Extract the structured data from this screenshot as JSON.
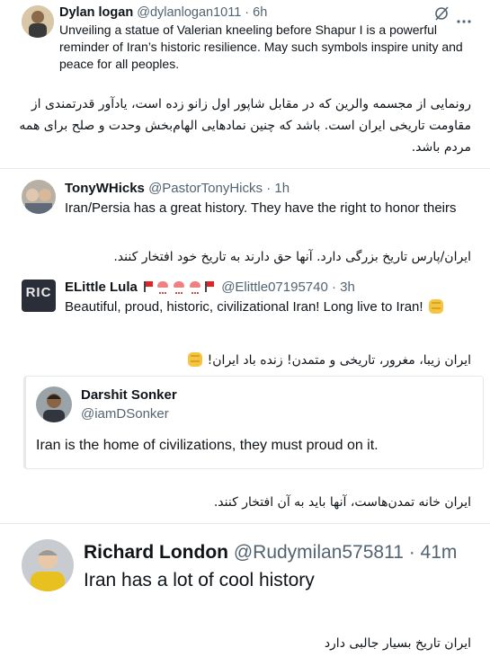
{
  "tweets": [
    {
      "author": "Dylan logan",
      "handle": "@dylanlogan1011",
      "time": "· 6h",
      "text": "Unveiling a statue of Valerian kneeling before Shapur I is a powerful reminder of Iran’s historic resilience. May such symbols inspire unity and peace for all peoples.",
      "translation": "رونمایی از مجسمه والرین که در مقابل شاپور اول زانو زده است، یادآور قدرتمندی از مقاومت تاریخی ایران است. باشد که چنین نمادهایی الهام‌بخش وحدت و صلح برای همه مردم باشد."
    },
    {
      "author": "TonyWHicks",
      "handle": "@PastorTonyHicks",
      "time": "· 1h",
      "text": "Iran/Persia has a great history. They have the right to honor theirs",
      "translation": "ایران/پارس تاریخ بزرگی دارد. آنها حق دارند به تاریخ خود افتخار کنند."
    },
    {
      "author": "ELittle Lula",
      "avatar_text": "RIC",
      "handle": "@Elittle07195740",
      "time": "· 3h",
      "text": "Beautiful, proud, historic, civilizational Iran! Long live to Iran!",
      "translation": "ایران زیبا، مغرور، تاریخی و متمدن! زنده باد ایران!"
    },
    {
      "author": "Darshit Sonker",
      "handle": "@iamDSonker",
      "text": "Iran is the home of civilizations, they must proud on it.",
      "translation": "ایران خانه تمدن‌هاست، آنها باید به آن افتخار کنند."
    },
    {
      "author": "Richard London",
      "handle": "@Rudymilan575811",
      "time": "· 41m",
      "text": "Iran has a lot of cool history",
      "translation": "ایران تاریخ بسیار جالبی دارد"
    }
  ],
  "icons": [
    "grok-icon",
    "more-icon",
    "red-flag-icon",
    "pink-octopus-icon",
    "fist-icon"
  ]
}
